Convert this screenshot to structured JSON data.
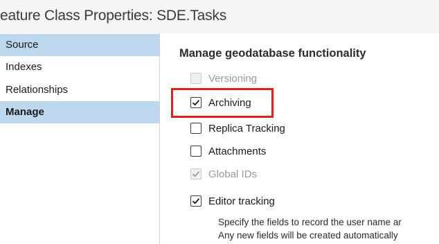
{
  "window": {
    "title": "eature Class Properties: SDE.Tasks"
  },
  "sidebar": {
    "items": [
      {
        "label": "Source"
      },
      {
        "label": "Indexes"
      },
      {
        "label": "Relationships"
      },
      {
        "label": "Manage"
      }
    ]
  },
  "manage": {
    "heading": "Manage geodatabase functionality",
    "options": [
      {
        "label": "Versioning",
        "checked": false,
        "enabled": false
      },
      {
        "label": "Archiving",
        "checked": true,
        "enabled": true
      },
      {
        "label": "Replica Tracking",
        "checked": false,
        "enabled": true
      },
      {
        "label": "Attachments",
        "checked": false,
        "enabled": true
      },
      {
        "label": "Global IDs",
        "checked": true,
        "enabled": false
      },
      {
        "label": "Editor tracking",
        "checked": true,
        "enabled": true
      }
    ],
    "editor_description_line1": "Specify the fields to record the user name ar",
    "editor_description_line2": "Any new fields will be created automatically"
  },
  "colors": {
    "selected_bg": "#bcd7ee",
    "highlight_border": "#e0201b"
  }
}
